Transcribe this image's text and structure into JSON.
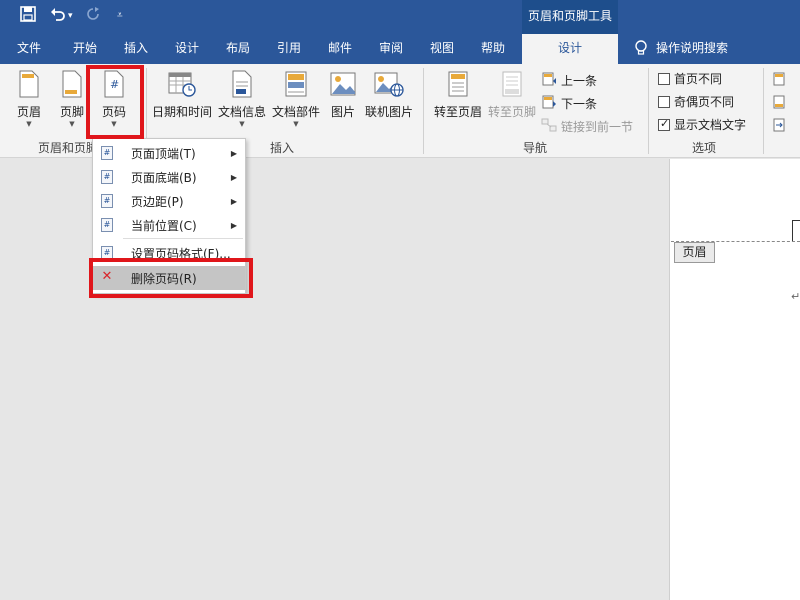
{
  "colors": {
    "brand": "#2b579a",
    "highlight_box": "#e0161b"
  },
  "qat": {
    "save_icon": "save-icon",
    "undo_icon": "undo-icon",
    "redo_icon": "redo-icon",
    "customize_icon": "customize-qat-icon"
  },
  "context_title": "页眉和页脚工具",
  "menu_tabs": [
    "文件",
    "开始",
    "插入",
    "设计",
    "布局",
    "引用",
    "邮件",
    "审阅",
    "视图",
    "帮助",
    "设计"
  ],
  "active_tab": "设计",
  "tell_me": "操作说明搜索",
  "ribbon": {
    "header": "页眉",
    "footer": "页脚",
    "page_number": "页码",
    "date_time": "日期和时间",
    "doc_info": "文档信息",
    "doc_parts": "文档部件",
    "picture": "图片",
    "online_picture": "联机图片",
    "goto_header": "转至页眉",
    "goto_footer": "转至页脚",
    "previous": "上一条",
    "next": "下一条",
    "link_previous": "链接到前一节",
    "diff_first": "首页不同",
    "diff_odd_even": "奇偶页不同",
    "show_doc_text": "显示文档文字",
    "group_hf": "页眉和页脚",
    "group_insert": "插入",
    "group_nav": "导航",
    "group_options": "选项"
  },
  "options": {
    "diff_first": false,
    "diff_odd_even": false,
    "show_doc_text": true
  },
  "dropdown": {
    "items": [
      {
        "label": "页面顶端(T)",
        "submenu": true
      },
      {
        "label": "页面底端(B)",
        "submenu": true
      },
      {
        "label": "页边距(P)",
        "submenu": true
      },
      {
        "label": "当前位置(C)",
        "submenu": true
      },
      {
        "label": "设置页码格式(F)...",
        "submenu": false
      },
      {
        "label": "删除页码(R)",
        "submenu": false
      }
    ]
  },
  "document": {
    "header_tag": "页眉",
    "para_mark": "↵"
  }
}
